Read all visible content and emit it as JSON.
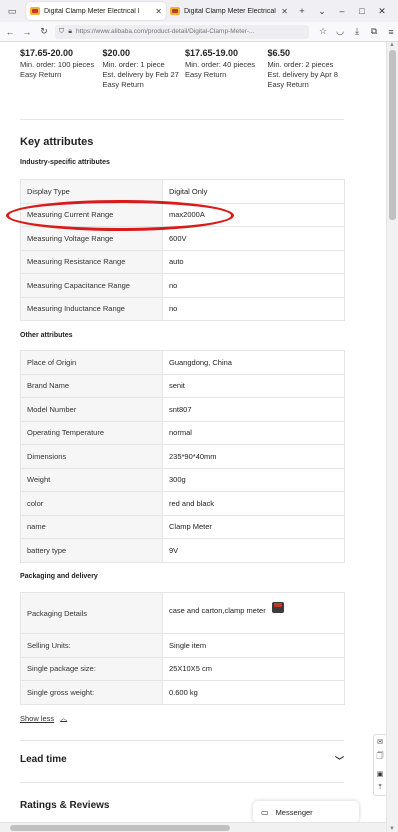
{
  "browser": {
    "tabs": [
      {
        "title": "Digital Clamp Meter Electrical I",
        "active": true
      },
      {
        "title": "Digital Clamp Meter Electrical I",
        "active": false
      }
    ],
    "new_tab": "+",
    "url": "https://www.alibaba.com/product-detail/Digital-Clamp-Meter-..."
  },
  "prices": [
    {
      "price": "$17.65-20.00",
      "min": "Min. order: 100 pieces",
      "extra": "Easy Return"
    },
    {
      "price": "$20.00",
      "min": "Min. order: 1 piece",
      "extra": "Est. delivery by Feb 27",
      "extra2": "Easy Return"
    },
    {
      "price": "$17.65-19.00",
      "min": "Min. order: 40 pieces",
      "extra": "Easy Return"
    },
    {
      "price": "$6.50",
      "min": "Min. order: 2 pieces",
      "extra": "Est. delivery by Apr 8",
      "extra2": "Easy Return"
    }
  ],
  "key_attributes": {
    "title": "Key attributes",
    "industry_title": "Industry-specific attributes",
    "industry": [
      {
        "k": "Display Type",
        "v": "Digital Only"
      },
      {
        "k": "Measuring Current Range",
        "v": "max2000A"
      },
      {
        "k": "Measuring Voltage Range",
        "v": "600V"
      },
      {
        "k": "Measuring Resistance Range",
        "v": "auto"
      },
      {
        "k": "Measuring Capacitance Range",
        "v": "no"
      },
      {
        "k": "Measuring Inductance Range",
        "v": "no"
      }
    ],
    "other_title": "Other attributes",
    "other": [
      {
        "k": "Place of Origin",
        "v": "Guangdong, China"
      },
      {
        "k": "Brand Name",
        "v": "senit"
      },
      {
        "k": "Model Number",
        "v": "snt807"
      },
      {
        "k": "Operating Temperature",
        "v": "normal"
      },
      {
        "k": "Dimensions",
        "v": "235*90*40mm"
      },
      {
        "k": "Weight",
        "v": "300g"
      },
      {
        "k": "color",
        "v": "red and black"
      },
      {
        "k": "name",
        "v": "Clamp Meter"
      },
      {
        "k": "battery type",
        "v": "9V"
      }
    ],
    "packaging_title": "Packaging and delivery",
    "packaging": [
      {
        "k": "Packaging Details",
        "v": "case and carton,clamp meter"
      },
      {
        "k": "Selling Units:",
        "v": "Single item"
      },
      {
        "k": "Single package size:",
        "v": "25X10X5 cm"
      },
      {
        "k": "Single gross weight:",
        "v": "0.600 kg"
      }
    ]
  },
  "show_less": "Show less",
  "lead_time": "Lead time",
  "ratings": "Ratings & Reviews",
  "messenger": "Messenger",
  "colors": {
    "highlight": "#d81b1b"
  }
}
